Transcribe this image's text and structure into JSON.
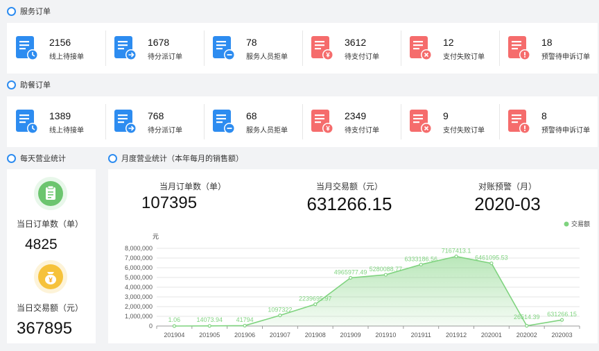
{
  "service_orders": {
    "title": "服务订单",
    "cards": [
      {
        "value": "2156",
        "label": "线上待接单",
        "icon": "list-clock-icon",
        "color": "#2d8cf0"
      },
      {
        "value": "1678",
        "label": "待分派订单",
        "icon": "list-arrow-icon",
        "color": "#2d8cf0"
      },
      {
        "value": "78",
        "label": "服务人员拒单",
        "icon": "list-minus-icon",
        "color": "#2d8cf0"
      },
      {
        "value": "3612",
        "label": "待支付订单",
        "icon": "list-yen-icon",
        "color": "#f56c6c"
      },
      {
        "value": "12",
        "label": "支付失败订单",
        "icon": "list-x-icon",
        "color": "#f56c6c"
      },
      {
        "value": "18",
        "label": "预警待申诉订单",
        "icon": "list-warning-icon",
        "color": "#f56c6c"
      }
    ]
  },
  "meal_orders": {
    "title": "助餐订单",
    "cards": [
      {
        "value": "1389",
        "label": "线上待接单",
        "icon": "list-clock-icon",
        "color": "#2d8cf0"
      },
      {
        "value": "768",
        "label": "待分派订单",
        "icon": "list-arrow-icon",
        "color": "#2d8cf0"
      },
      {
        "value": "68",
        "label": "服务人员拒单",
        "icon": "list-minus-icon",
        "color": "#2d8cf0"
      },
      {
        "value": "2349",
        "label": "待支付订单",
        "icon": "list-yen-icon",
        "color": "#f56c6c"
      },
      {
        "value": "9",
        "label": "支付失败订单",
        "icon": "list-x-icon",
        "color": "#f56c6c"
      },
      {
        "value": "8",
        "label": "预警待申诉订单",
        "icon": "list-warning-icon",
        "color": "#f56c6c"
      }
    ]
  },
  "daily": {
    "title": "每天营业统计",
    "orders_label": "当日订单数（单）",
    "orders_value": "4825",
    "amount_label": "当日交易额（元）",
    "amount_value": "367895"
  },
  "monthly": {
    "title": "月度营业统计（本年每月的销售额）",
    "kpis": [
      {
        "label": "当月订单数（单）",
        "value": "107395"
      },
      {
        "label": "当月交易额（元）",
        "value": "631266.15"
      },
      {
        "label": "对账预警（月）",
        "value": "2020-03"
      }
    ]
  },
  "colors": {
    "accent": "#2d8cf0",
    "warn": "#f56c6c",
    "chart": "#7fd37f"
  },
  "chart_data": {
    "type": "area",
    "x": [
      "201904",
      "201905",
      "201906",
      "201907",
      "201908",
      "201909",
      "201910",
      "201911",
      "201912",
      "202001",
      "202002",
      "202003"
    ],
    "series": [
      {
        "name": "交易额",
        "values": [
          1.06,
          14073.94,
          41794,
          1097322,
          2239695.97,
          4965977.49,
          5280088.77,
          6333186.56,
          7167413.1,
          6461095.53,
          26514.39,
          631266.15
        ],
        "labels": [
          "1.06",
          "14073.94",
          "41794",
          "1097322",
          "2239695.97",
          "4965977.49",
          "5280088.77",
          "6333186.56",
          "7167413.1",
          "6461095.53",
          "26514.39",
          "631266.15"
        ]
      }
    ],
    "ylabel": "元",
    "yticks": [
      "0",
      "1,000,000",
      "2,000,000",
      "3,000,000",
      "4,000,000",
      "5,000,000",
      "6,000,000",
      "7,000,000",
      "8,000,000"
    ],
    "ylim": [
      0,
      8000000
    ],
    "legend": "top-right",
    "grid": true
  }
}
